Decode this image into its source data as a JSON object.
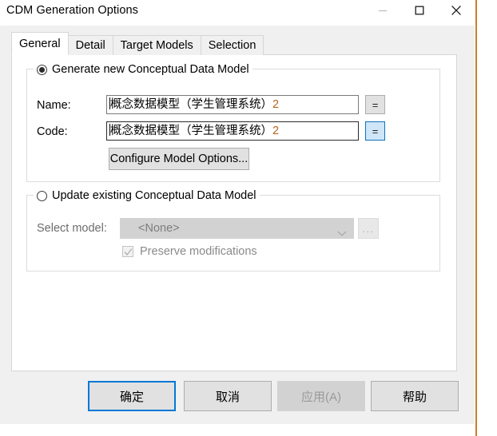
{
  "window": {
    "title": "CDM Generation Options",
    "controls": {
      "minimize": "minimize-icon",
      "maximize": "maximize-icon",
      "close": "close-icon"
    }
  },
  "tabs": [
    {
      "label": "General",
      "active": true
    },
    {
      "label": "Detail",
      "active": false
    },
    {
      "label": "Target Models",
      "active": false
    },
    {
      "label": "Selection",
      "active": false
    }
  ],
  "generate_group": {
    "radio_label": "Generate new Conceptual Data Model",
    "radio_selected": true,
    "name": {
      "label": "Name:",
      "value": "概念数据模型（学生管理系统）",
      "value_suffix": "2",
      "equals_button": "=",
      "focused": false
    },
    "code": {
      "label": "Code:",
      "value": "概念数据模型（学生管理系统）",
      "value_suffix": "2",
      "equals_button": "=",
      "focused": true
    },
    "configure_button": "Configure Model Options..."
  },
  "update_group": {
    "radio_label": "Update existing Conceptual Data Model",
    "radio_selected": false,
    "select_model": {
      "label": "Select model:",
      "value": "<None>",
      "browse_button": "...",
      "disabled": true
    },
    "preserve": {
      "label": "Preserve modifications",
      "checked": true,
      "disabled": true
    }
  },
  "footer": {
    "ok": "确定",
    "cancel": "取消",
    "apply": "应用(A)",
    "help": "帮助",
    "apply_disabled": true,
    "ok_is_default": true
  },
  "colors": {
    "accent": "#0078d7",
    "focus_fill": "#cfe6f8",
    "suffix_text": "#b5651d",
    "dialog_bg": "#f0f0f0",
    "edge_line": "#c8812a"
  }
}
